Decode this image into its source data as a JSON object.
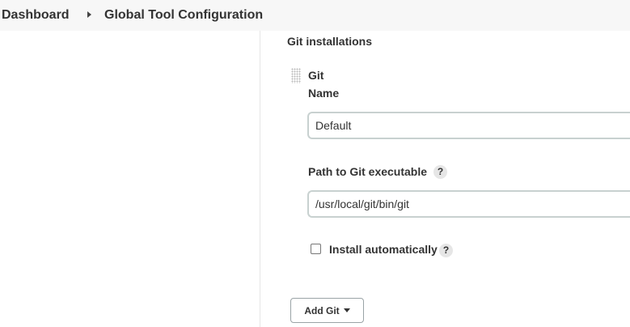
{
  "breadcrumb": {
    "items": [
      "Dashboard",
      "Global Tool Configuration"
    ]
  },
  "git_section": {
    "title": "Git installations",
    "installation": {
      "heading": "Git",
      "name_label": "Name",
      "name_value": "Default",
      "path_label": "Path to Git executable",
      "path_value": "/usr/local/git/bin/git",
      "help_glyph": "?",
      "install_auto_label": "Install automatically",
      "install_auto_checked": false
    },
    "add_button_label": "Add Git"
  },
  "icons": {
    "breadcrumb_separator": "caret-right-icon",
    "drag_handle": "drag-handle-icon",
    "dropdown": "caret-down-icon",
    "help": "help-icon"
  }
}
